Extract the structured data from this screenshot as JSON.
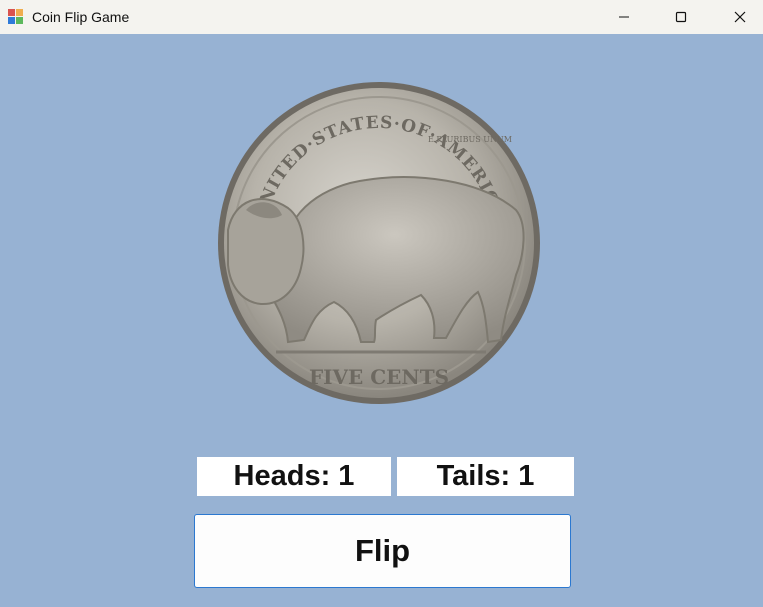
{
  "window": {
    "title": "Coin Flip Game",
    "icon": "app-icon",
    "controls": {
      "minimize": "minimize-icon",
      "maximize": "maximize-icon",
      "close": "close-icon"
    }
  },
  "coin": {
    "image": "buffalo-nickel-tails-image",
    "legend_top": "UNITED·STATES·OF·AMERICA",
    "motto": "E PLURIBUS UNUM",
    "denomination": "FIVE CENTS"
  },
  "counters": {
    "heads": "Heads: 1",
    "tails": "Tails: 1"
  },
  "buttons": {
    "flip": "Flip"
  },
  "colors": {
    "background": "#97b2d3",
    "titlebar": "#f4f3ef",
    "button_border": "#2b78d0"
  }
}
